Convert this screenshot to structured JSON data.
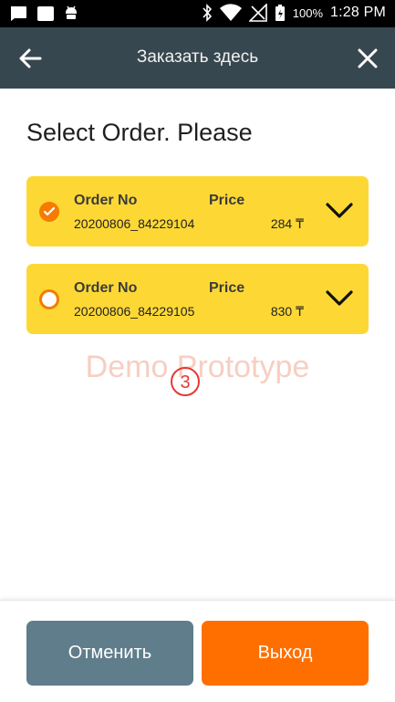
{
  "status_bar": {
    "battery": "100%",
    "time": "1:28 PM",
    "icons": [
      "message-icon",
      "image-icon",
      "android-icon",
      "bluetooth-icon",
      "wifi-icon",
      "no-signal-icon",
      "battery-charging-icon"
    ]
  },
  "app_bar": {
    "title": "Заказать здесь",
    "back_icon": "arrow-left-icon",
    "close_icon": "close-icon"
  },
  "heading": "Select Order. Please",
  "orders": [
    {
      "order_label": "Order No",
      "price_label": "Price",
      "order_no": "20200806_84229104",
      "price": "284 ₸",
      "selected": true
    },
    {
      "order_label": "Order No",
      "price_label": "Price",
      "order_no": "20200806_84229105",
      "price": "830 ₸",
      "selected": false
    }
  ],
  "watermark": "Demo Prototype",
  "watermark_number": "3",
  "footer": {
    "cancel_label": "Отменить",
    "exit_label": "Выход"
  },
  "colors": {
    "app_bar": "#37474f",
    "card": "#fdd835",
    "accent": "#f57c00",
    "cancel_button": "#607d8b",
    "exit_button": "#ff6f00"
  }
}
